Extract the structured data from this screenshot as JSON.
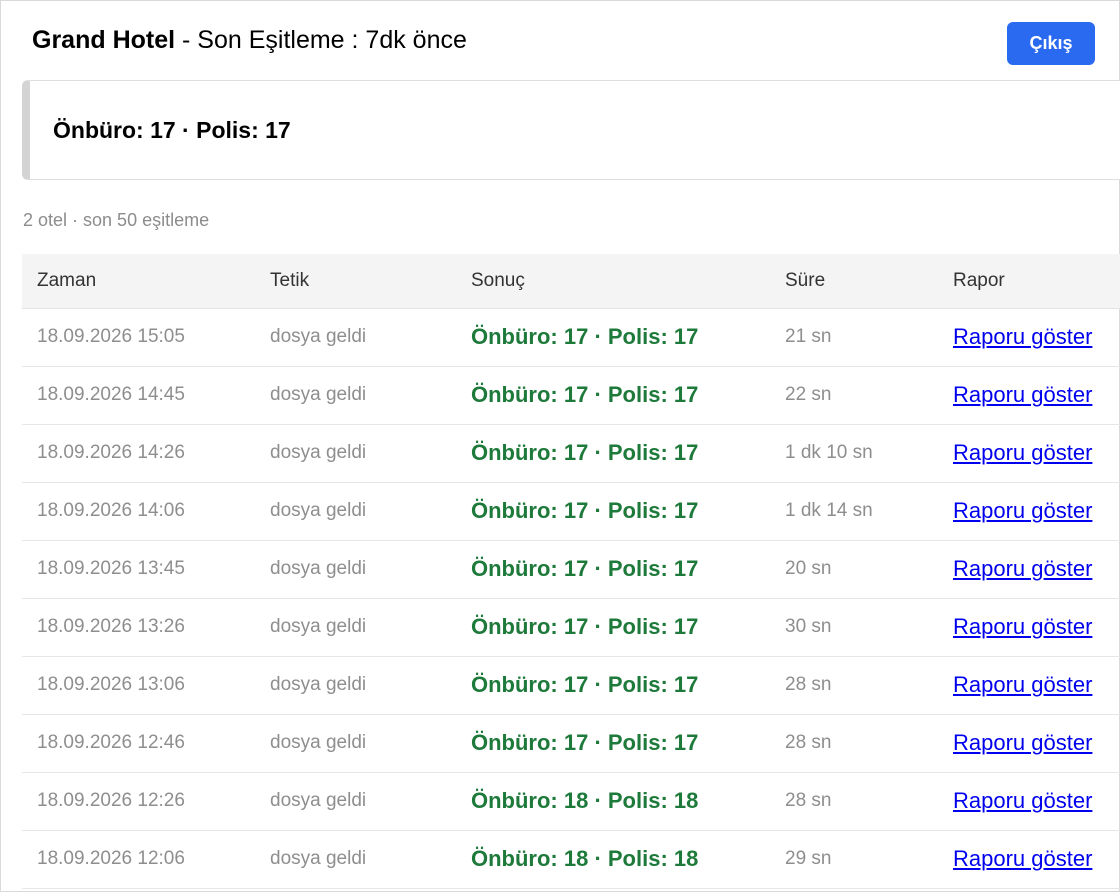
{
  "header": {
    "hotel_name": "Grand Hotel",
    "sync_text": " - Son Eşitleme : 7dk önce",
    "logout_label": "Çıkış"
  },
  "summary": {
    "text": "Önbüro: 17 · Polis: 17"
  },
  "meta": {
    "text": "2 otel · son 50 eşitleme"
  },
  "table": {
    "columns": [
      "Zaman",
      "Tetik",
      "Sonuç",
      "Süre",
      "Rapor"
    ],
    "rows": [
      {
        "time": "18.09.2026 15:05",
        "trigger": "dosya geldi",
        "result": "Önbüro: 17 · Polis: 17",
        "duration": "21 sn",
        "report": "Raporu göster"
      },
      {
        "time": "18.09.2026 14:45",
        "trigger": "dosya geldi",
        "result": "Önbüro: 17 · Polis: 17",
        "duration": "22 sn",
        "report": "Raporu göster"
      },
      {
        "time": "18.09.2026 14:26",
        "trigger": "dosya geldi",
        "result": "Önbüro: 17 · Polis: 17",
        "duration": "1 dk 10 sn",
        "report": "Raporu göster"
      },
      {
        "time": "18.09.2026 14:06",
        "trigger": "dosya geldi",
        "result": "Önbüro: 17 · Polis: 17",
        "duration": "1 dk 14 sn",
        "report": "Raporu göster"
      },
      {
        "time": "18.09.2026 13:45",
        "trigger": "dosya geldi",
        "result": "Önbüro: 17 · Polis: 17",
        "duration": "20 sn",
        "report": "Raporu göster"
      },
      {
        "time": "18.09.2026 13:26",
        "trigger": "dosya geldi",
        "result": "Önbüro: 17 · Polis: 17",
        "duration": "30 sn",
        "report": "Raporu göster"
      },
      {
        "time": "18.09.2026 13:06",
        "trigger": "dosya geldi",
        "result": "Önbüro: 17 · Polis: 17",
        "duration": "28 sn",
        "report": "Raporu göster"
      },
      {
        "time": "18.09.2026 12:46",
        "trigger": "dosya geldi",
        "result": "Önbüro: 17 · Polis: 17",
        "duration": "28 sn",
        "report": "Raporu göster"
      },
      {
        "time": "18.09.2026 12:26",
        "trigger": "dosya geldi",
        "result": "Önbüro: 18 · Polis: 18",
        "duration": "28 sn",
        "report": "Raporu göster"
      },
      {
        "time": "18.09.2026 12:06",
        "trigger": "dosya geldi",
        "result": "Önbüro: 18 · Polis: 18",
        "duration": "29 sn",
        "report": "Raporu göster"
      }
    ]
  },
  "colors": {
    "accent": "#2a6af0",
    "result_green": "#1e7a3a",
    "link": "#0000ee"
  }
}
